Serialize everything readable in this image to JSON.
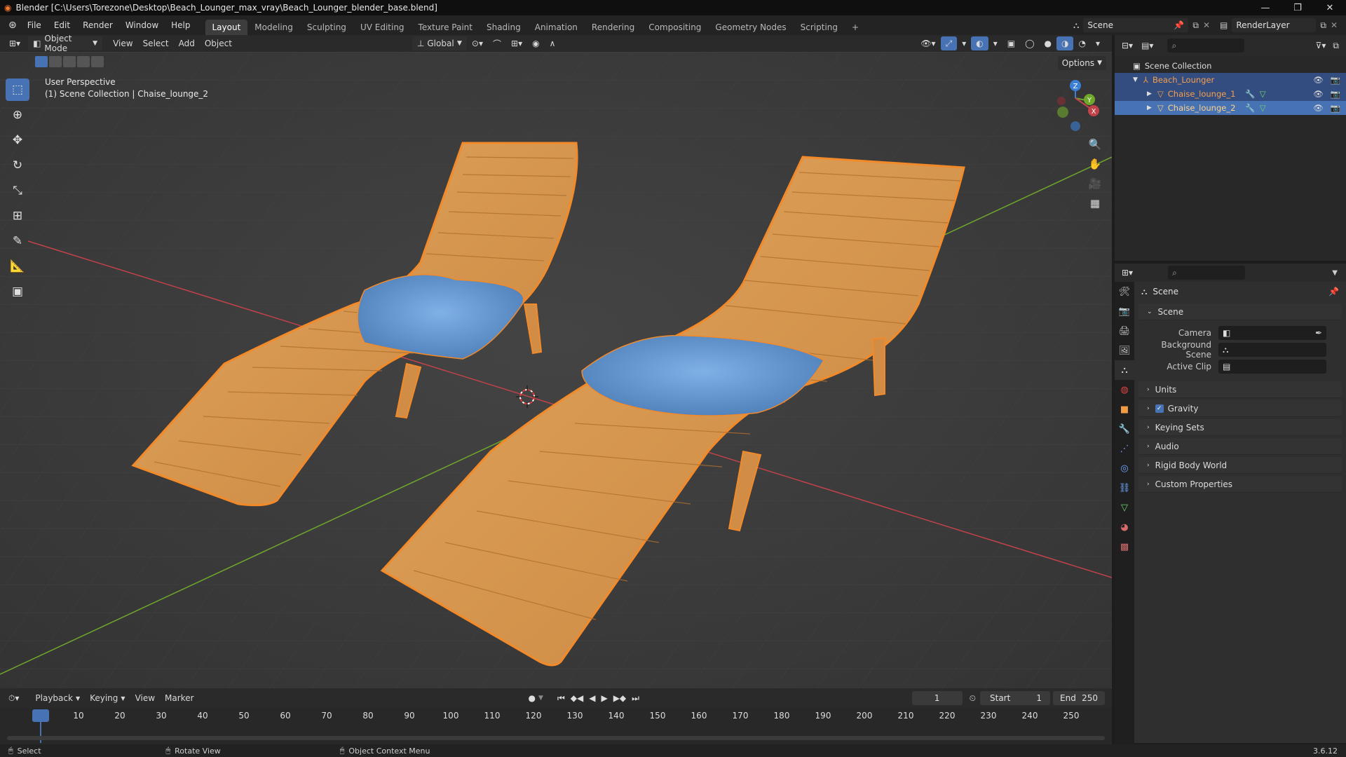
{
  "title_bar": {
    "title": "Blender [C:\\Users\\Torezone\\Desktop\\Beach_Lounger_max_vray\\Beach_Lounger_blender_base.blend]"
  },
  "menubar": {
    "menus": [
      "File",
      "Edit",
      "Render",
      "Window",
      "Help"
    ],
    "workspaces": [
      "Layout",
      "Modeling",
      "Sculpting",
      "UV Editing",
      "Texture Paint",
      "Shading",
      "Animation",
      "Rendering",
      "Compositing",
      "Geometry Nodes",
      "Scripting"
    ],
    "active_workspace": "Layout",
    "add_tab": "+",
    "scene_name": "Scene",
    "render_layer": "RenderLayer"
  },
  "viewport_header": {
    "mode": "Object Mode",
    "menus": [
      "View",
      "Select",
      "Add",
      "Object"
    ],
    "transform_orientation": "Global",
    "options_label": "Options"
  },
  "viewport": {
    "perspective_label": "User Perspective",
    "collection_label": "(1) Scene Collection | Chaise_lounge_2",
    "gizmo_axes": [
      "X",
      "Y",
      "Z"
    ]
  },
  "outliner": {
    "root": "Scene Collection",
    "items": [
      {
        "name": "Beach_Lounger",
        "level": 1
      },
      {
        "name": "Chaise_lounge_1",
        "level": 2
      },
      {
        "name": "Chaise_lounge_2",
        "level": 2
      }
    ]
  },
  "properties": {
    "context_title": "Scene",
    "section_title": "Scene",
    "fields": [
      {
        "label": "Camera",
        "value": ""
      },
      {
        "label": "Background Scene",
        "value": ""
      },
      {
        "label": "Active Clip",
        "value": ""
      }
    ],
    "panels": [
      "Units",
      "Gravity",
      "Keying Sets",
      "Audio",
      "Rigid Body World",
      "Custom Properties"
    ],
    "gravity_checked": true
  },
  "timeline": {
    "menus": [
      "Playback",
      "Keying",
      "View",
      "Marker"
    ],
    "current_frame": "1",
    "start_label": "Start",
    "start": "1",
    "end_label": "End",
    "end": "250",
    "ticks": [
      "1",
      "10",
      "20",
      "30",
      "40",
      "50",
      "60",
      "70",
      "80",
      "90",
      "100",
      "110",
      "120",
      "130",
      "140",
      "150",
      "160",
      "170",
      "180",
      "190",
      "200",
      "210",
      "220",
      "230",
      "240",
      "250"
    ]
  },
  "statusbar": {
    "hints": [
      "Select",
      "Rotate View",
      "Object Context Menu"
    ],
    "version": "3.6.12"
  },
  "colors": {
    "accent": "#4772b3",
    "selection_orange": "#f28a2a",
    "wood": "#d99a4e",
    "pillow": "#6f9fd6",
    "x_axis": "#c2424a",
    "y_axis": "#6fa82b",
    "z_axis": "#3b7fd6"
  }
}
